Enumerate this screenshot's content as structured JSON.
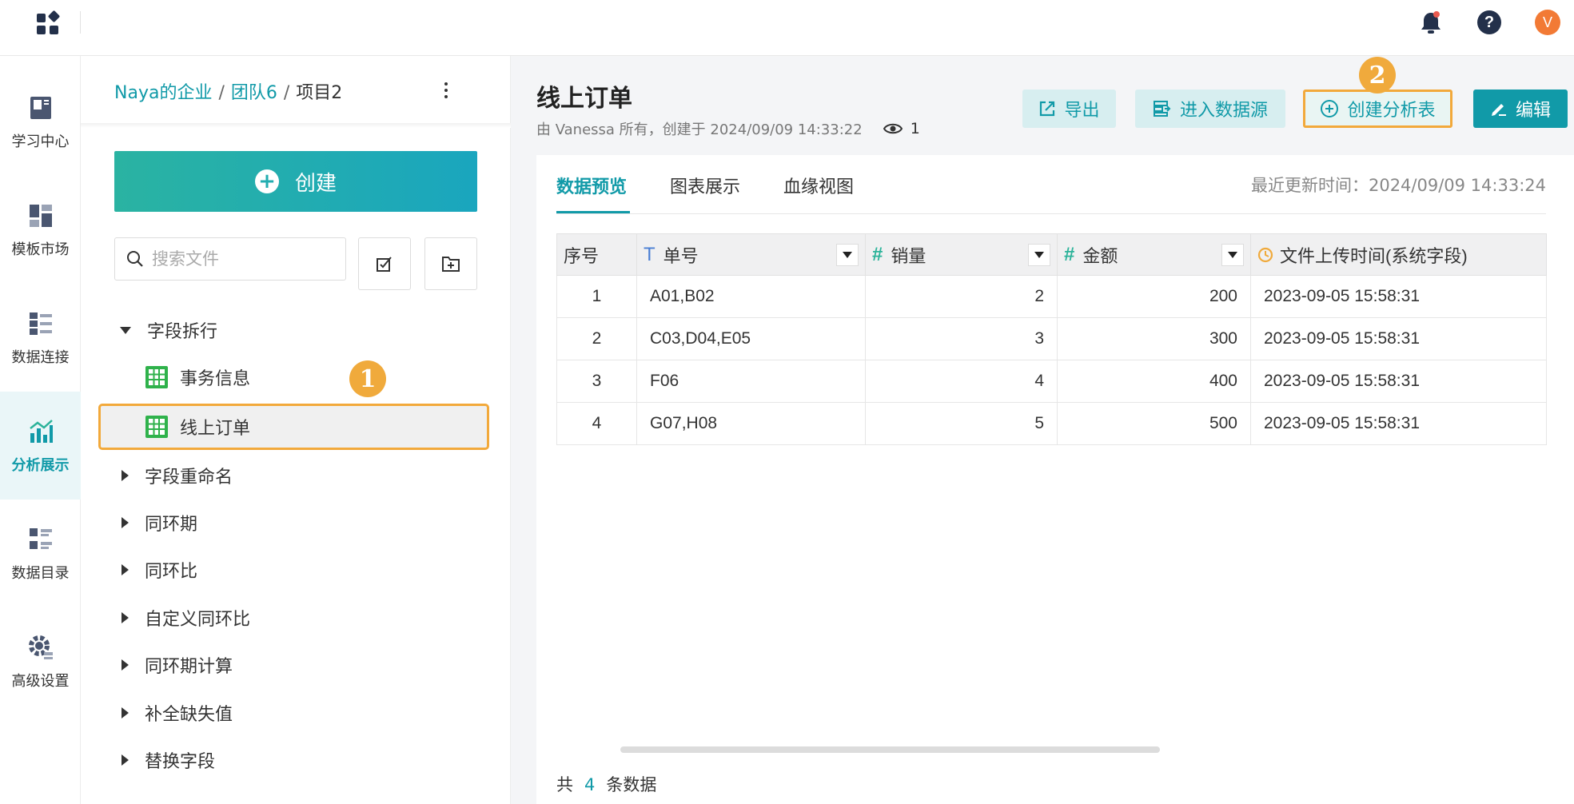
{
  "leftnav": {
    "items": [
      {
        "label": "学习中心",
        "icon": "book-icon"
      },
      {
        "label": "模板市场",
        "icon": "template-icon"
      },
      {
        "label": "数据连接",
        "icon": "data-connect-icon"
      },
      {
        "label": "分析展示",
        "icon": "chart-icon",
        "active": true
      },
      {
        "label": "数据目录",
        "icon": "catalog-icon"
      },
      {
        "label": "高级设置",
        "icon": "gear-icon"
      }
    ]
  },
  "topbar": {
    "avatar_letter": "V",
    "help_glyph": "?"
  },
  "breadcrumb": {
    "org": "Naya的企业",
    "team": "团队6",
    "project": "项目2",
    "sep": "/"
  },
  "filepanel": {
    "create_label": "创建",
    "search_placeholder": "搜索文件",
    "tree": {
      "open_folder": "字段拆行",
      "files": [
        "事务信息",
        "线上订单"
      ],
      "folders": [
        "字段重命名",
        "同环期",
        "同环比",
        "自定义同环比",
        "同环期计算",
        "补全缺失值",
        "替换字段"
      ]
    },
    "badge1": "1"
  },
  "main": {
    "title": "线上订单",
    "subtitle": "由 Vanessa 所有，创建于 2024/09/09 14:33:22",
    "views": "1",
    "buttons": {
      "export": "导出",
      "enter_source": "进入数据源",
      "create_analysis": "创建分析表",
      "edit": "编辑"
    },
    "badge2": "2",
    "tabs": [
      "数据预览",
      "图表展示",
      "血缘视图"
    ],
    "last_update": "最近更新时间：2024/09/09 14:33:24",
    "table": {
      "headers": [
        "序号",
        "单号",
        "销量",
        "金额",
        "文件上传时间(系统字段)"
      ],
      "rows": [
        [
          "1",
          "A01,B02",
          "2",
          "200",
          "2023-09-05 15:58:31"
        ],
        [
          "2",
          "C03,D04,E05",
          "3",
          "300",
          "2023-09-05 15:58:31"
        ],
        [
          "3",
          "F06",
          "4",
          "400",
          "2023-09-05 15:58:31"
        ],
        [
          "4",
          "G07,H08",
          "5",
          "500",
          "2023-09-05 15:58:31"
        ]
      ]
    },
    "footer": {
      "prefix": "共",
      "count": "4",
      "suffix": "条数据"
    }
  },
  "colors": {
    "accent": "#119aa8",
    "highlight": "#f2a93b",
    "badge": "#f0aa3c",
    "avatar": "#f27a35"
  }
}
